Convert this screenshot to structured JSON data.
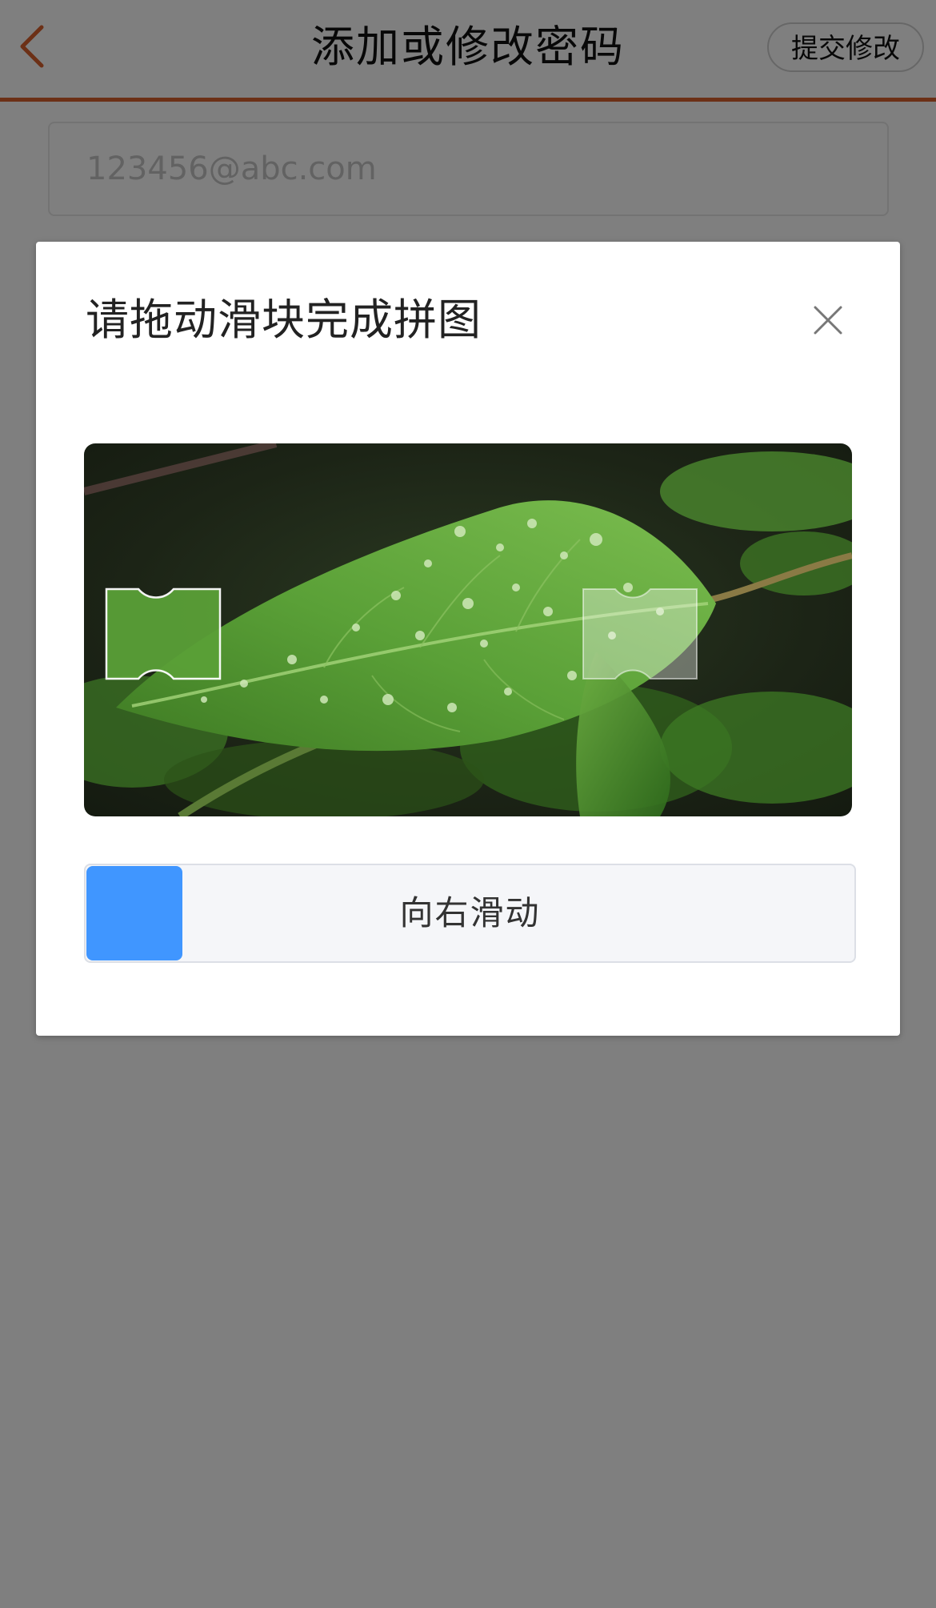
{
  "nav": {
    "title": "添加或修改密码",
    "submit_label": "提交修改",
    "back_icon": "chevron-left-icon",
    "accent_color": "#d9602d"
  },
  "form": {
    "email_placeholder": "123456@abc.com"
  },
  "captcha": {
    "title": "请拖动滑块完成拼图",
    "close_icon": "close-icon",
    "image_description_icon": "leaf-photo",
    "slider_hint": "向右滑动",
    "slider_progress": 0,
    "handle_color": "#4096ff"
  }
}
